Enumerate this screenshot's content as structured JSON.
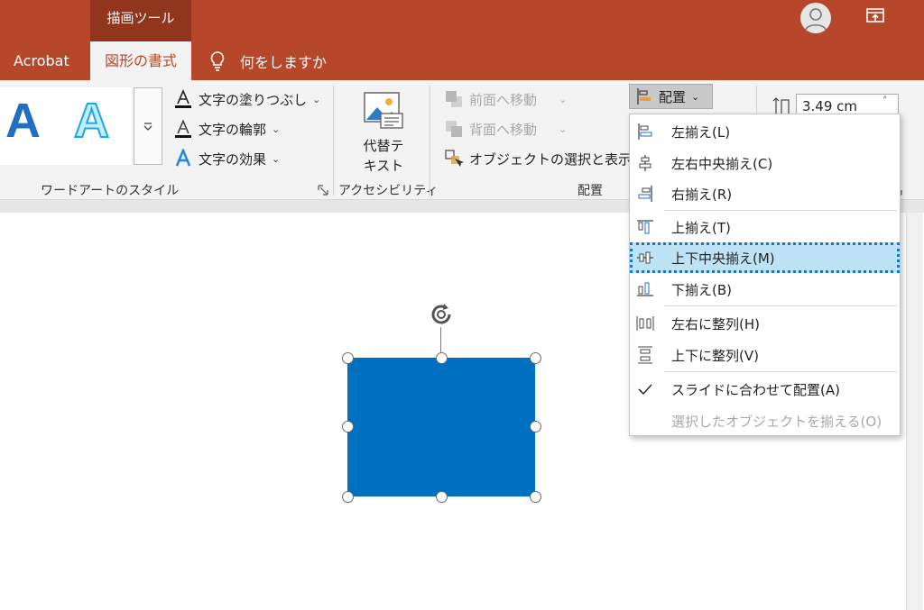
{
  "window": {
    "context_group": "描画ツール",
    "tabs": [
      {
        "label": "Acrobat"
      },
      {
        "label": "図形の書式"
      }
    ],
    "tell_me": "何をしますか",
    "avatar_icon": "user-avatar-icon",
    "share_icon": "ribbon-display-options-icon"
  },
  "ribbon": {
    "wordart_group": {
      "label": "ワードアートのスタイル",
      "text_fill": "文字の塗りつぶし",
      "text_outline": "文字の輪郭",
      "text_effects": "文字の効果"
    },
    "accessibility_group": {
      "label": "アクセシビリティ",
      "alt_text_line1": "代替テ",
      "alt_text_line2": "キスト"
    },
    "arrange_group": {
      "label": "配置",
      "bring_forward": "前面へ移動",
      "send_backward": "背面へ移動",
      "selection_pane": "オブジェクトの選択と表示",
      "align_button": "配置"
    },
    "size_group": {
      "height_value": "3.49 cm"
    }
  },
  "align_menu": {
    "items": [
      {
        "label": "左揃え(L)",
        "icon": "align-left-icon"
      },
      {
        "label": "左右中央揃え(C)",
        "icon": "align-center-icon"
      },
      {
        "label": "右揃え(R)",
        "icon": "align-right-icon"
      },
      {
        "label": "上揃え(T)",
        "icon": "align-top-icon"
      },
      {
        "label": "上下中央揃え(M)",
        "icon": "align-middle-icon"
      },
      {
        "label": "下揃え(B)",
        "icon": "align-bottom-icon"
      },
      {
        "label": "左右に整列(H)",
        "icon": "distribute-horizontal-icon"
      },
      {
        "label": "上下に整列(V)",
        "icon": "distribute-vertical-icon"
      },
      {
        "label": "スライドに合わせて配置(A)",
        "icon": "checkmark-icon"
      },
      {
        "label": "選択したオブジェクトを揃える(O)",
        "icon": ""
      }
    ],
    "highlighted_index": 4
  },
  "colors": {
    "accent": "#b7472a",
    "shape_fill": "#0070c0",
    "highlight": "#bfe3f6"
  }
}
